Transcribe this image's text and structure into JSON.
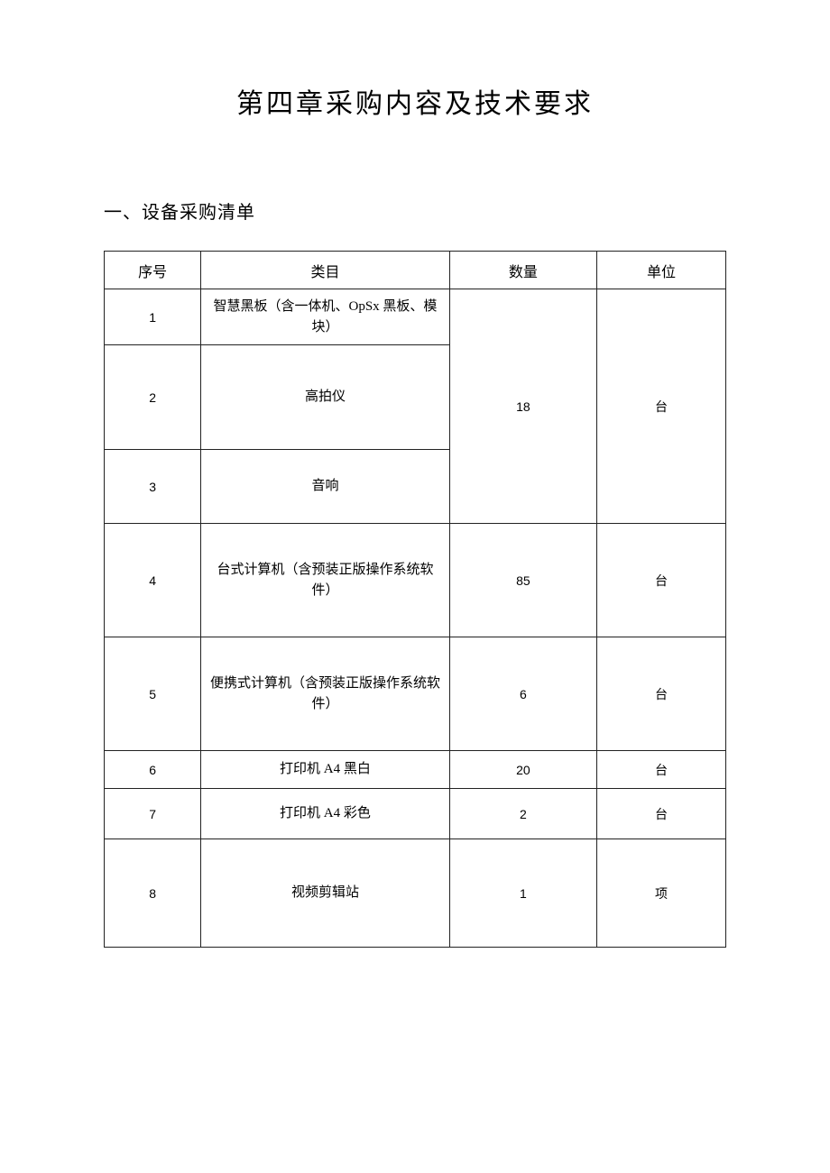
{
  "title": "第四章采购内容及技术要求",
  "section_heading": "一、设备采购清单",
  "headers": {
    "seq": "序号",
    "category": "类目",
    "quantity": "数量",
    "unit": "单位"
  },
  "rows": [
    {
      "seq": "1",
      "category": "智慧黑板（含一体机、OpSx 黑板、模块）"
    },
    {
      "seq": "2",
      "category": "高拍仪"
    },
    {
      "seq": "3",
      "category": "音响"
    },
    {
      "seq": "4",
      "category": "台式计算机（含预装正版操作系统软件）",
      "quantity": "85",
      "unit": "台"
    },
    {
      "seq": "5",
      "category": "便携式计算机（含预装正版操作系统软件）",
      "quantity": "6",
      "unit": "台"
    },
    {
      "seq": "6",
      "category": "打印机 A4 黑白",
      "quantity": "20",
      "unit": "台"
    },
    {
      "seq": "7",
      "category": "打印机 A4 彩色",
      "quantity": "2",
      "unit": "台"
    },
    {
      "seq": "8",
      "category": "视频剪辑站",
      "quantity": "1",
      "unit": "项"
    }
  ],
  "merged_group_1": {
    "quantity": "18",
    "unit": "台"
  }
}
